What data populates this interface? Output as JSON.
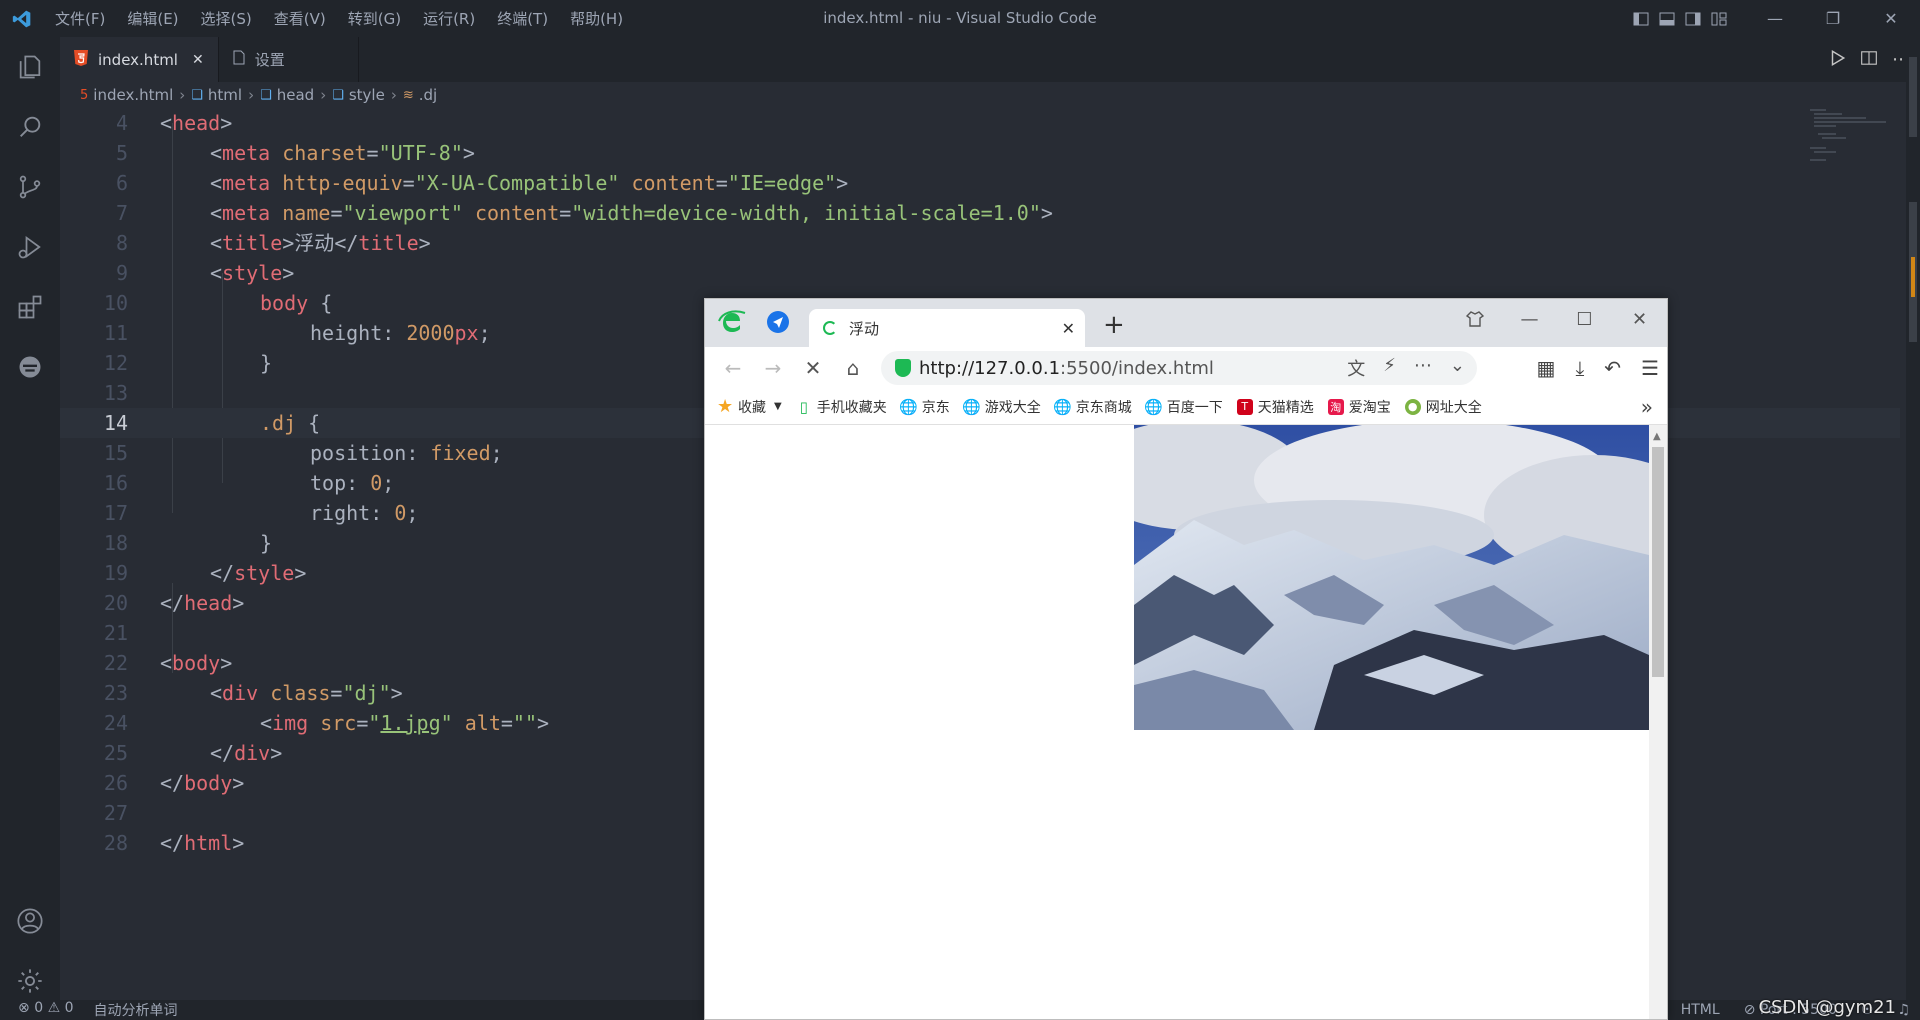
{
  "vscode": {
    "menus": [
      "文件(F)",
      "编辑(E)",
      "选择(S)",
      "查看(V)",
      "转到(G)",
      "运行(R)",
      "终端(T)",
      "帮助(H)"
    ],
    "window_title": "index.html - niu - Visual Studio Code",
    "tabs": [
      {
        "label": "index.html",
        "icon": "html5-icon",
        "active": true
      },
      {
        "label": "设置",
        "icon": "file-icon",
        "active": false
      }
    ],
    "breadcrumb": [
      "index.html",
      "html",
      "head",
      "style",
      ".dj"
    ],
    "activity_icons": [
      "explorer-icon",
      "search-icon",
      "source-control-icon",
      "run-debug-icon",
      "extensions-icon",
      "remote-icon",
      "account-icon",
      "gear-icon"
    ],
    "code_lines": [
      {
        "n": "4"
      },
      {
        "n": "5"
      },
      {
        "n": "6"
      },
      {
        "n": "7"
      },
      {
        "n": "8"
      },
      {
        "n": "9"
      },
      {
        "n": "10"
      },
      {
        "n": "11"
      },
      {
        "n": "12"
      },
      {
        "n": "13"
      },
      {
        "n": "14",
        "current": true
      },
      {
        "n": "15"
      },
      {
        "n": "16"
      },
      {
        "n": "17"
      },
      {
        "n": "18"
      },
      {
        "n": "19"
      },
      {
        "n": "20"
      },
      {
        "n": "21"
      },
      {
        "n": "22"
      },
      {
        "n": "23"
      },
      {
        "n": "24"
      },
      {
        "n": "25"
      },
      {
        "n": "26"
      },
      {
        "n": "27"
      },
      {
        "n": "28"
      }
    ],
    "code": {
      "l4": [
        "<",
        "head",
        ">"
      ],
      "l5": [
        "<",
        "meta",
        " charset",
        "=",
        "\"UTF-8\"",
        ">"
      ],
      "l6": [
        "<",
        "meta",
        " http-equiv",
        "=",
        "\"X-UA-Compatible\"",
        " content",
        "=",
        "\"IE=edge\"",
        ">"
      ],
      "l7": [
        "<",
        "meta",
        " name",
        "=",
        "\"viewport\"",
        " content",
        "=",
        "\"width=device-width, initial-scale=1.0\"",
        ">"
      ],
      "l8": [
        "<",
        "title",
        ">",
        "浮动",
        "</",
        "title",
        ">"
      ],
      "l9": [
        "<",
        "style",
        ">"
      ],
      "l10": [
        "body",
        " {"
      ],
      "l11": [
        "height",
        ": ",
        "2000",
        "px",
        ";"
      ],
      "l12": [
        "}"
      ],
      "l14": [
        ".dj",
        " {"
      ],
      "l15": [
        "position",
        ": ",
        "fixed",
        ";"
      ],
      "l16": [
        "top",
        ": ",
        "0",
        ";"
      ],
      "l17": [
        "right",
        ": ",
        "0",
        ";"
      ],
      "l18": [
        "}"
      ],
      "l19": [
        "</",
        "style",
        ">"
      ],
      "l20": [
        "</",
        "head",
        ">"
      ],
      "l22": [
        "<",
        "body",
        ">"
      ],
      "l23": [
        "<",
        "div",
        " class",
        "=",
        "\"dj\"",
        ">"
      ],
      "l24": [
        "<",
        "img",
        " src",
        "=",
        "\"",
        "1.jpg",
        "\"",
        " alt",
        "=",
        "\"\"",
        ">"
      ],
      "l25": [
        "</",
        "div",
        ">"
      ],
      "l26": [
        "</",
        "body",
        ">"
      ],
      "l28": [
        "</",
        "html",
        ">"
      ]
    },
    "status": {
      "errors": "0",
      "warnings": "0",
      "extra": "自动分析单词",
      "language": "HTML",
      "port": "Port : 5500"
    },
    "watermark": "CSDN @gym21"
  },
  "browser": {
    "tab_title": "浮动",
    "url_host": "http://127.0.0.1",
    "url_rest": ":5500/index.html",
    "bookmarks": [
      {
        "label": "收藏",
        "icon": "star-icon"
      },
      {
        "label": "手机收藏夹",
        "icon": "phone-icon"
      },
      {
        "label": "京东",
        "icon": "globe-icon"
      },
      {
        "label": "游戏大全",
        "icon": "globe-icon"
      },
      {
        "label": "京东商城",
        "icon": "globe-icon"
      },
      {
        "label": "百度一下",
        "icon": "globe-icon"
      },
      {
        "label": "天猫精选",
        "icon": "tmall-icon"
      },
      {
        "label": "爱淘宝",
        "icon": "taobao-icon"
      },
      {
        "label": "网址大全",
        "icon": "portal-icon"
      }
    ],
    "more": "»",
    "colors": {
      "accent": "#1db954",
      "tab_bg": "#dee1e6"
    }
  }
}
